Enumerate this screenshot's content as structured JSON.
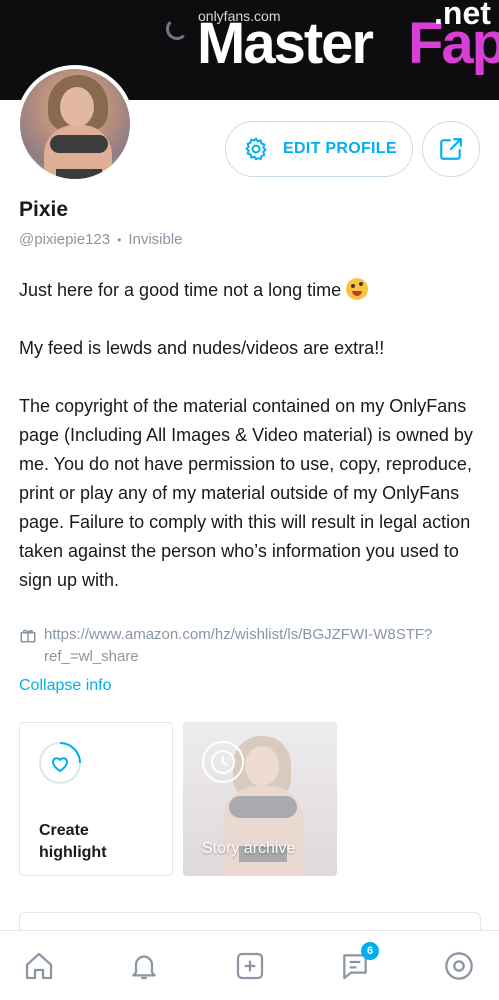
{
  "browser": {
    "url": "onlyfans.com"
  },
  "watermark": {
    "master": "Master",
    "fap": "Fap",
    "net": ".net"
  },
  "colors": {
    "accent": "#00aff0",
    "muted": "#8a96a3",
    "watermark_pink": "#d83fd6"
  },
  "profile": {
    "name": "Pixie",
    "handle": "@pixiepie123",
    "status": "Invisible",
    "edit_label": "EDIT PROFILE",
    "bio_line1": "Just here for a good time not a long time",
    "bio_line2": "My feed is lewds and nudes/videos are extra!!",
    "bio_line3": "The copyright of the material contained on my OnlyFans page (Including All Images & Video material) is owned by me. You do not have permission to use, copy, reproduce, print or play any of my material outside of my OnlyFans page. Failure to comply with this will result in legal action taken against the person who’s information you used to sign up with.",
    "wishlist_link": "https://www.amazon.com/hz/wishlist/ls/BGJZFWI-W8STF?ref_=wl_share",
    "collapse_label": "Collapse info"
  },
  "highlights": {
    "create_label": "Create highlight",
    "archive_label": "Story archive"
  },
  "nav": {
    "icons": [
      "home-icon",
      "bell-icon",
      "plus-square-icon",
      "messages-icon",
      "profile-icon"
    ],
    "messages_badge": "6"
  }
}
